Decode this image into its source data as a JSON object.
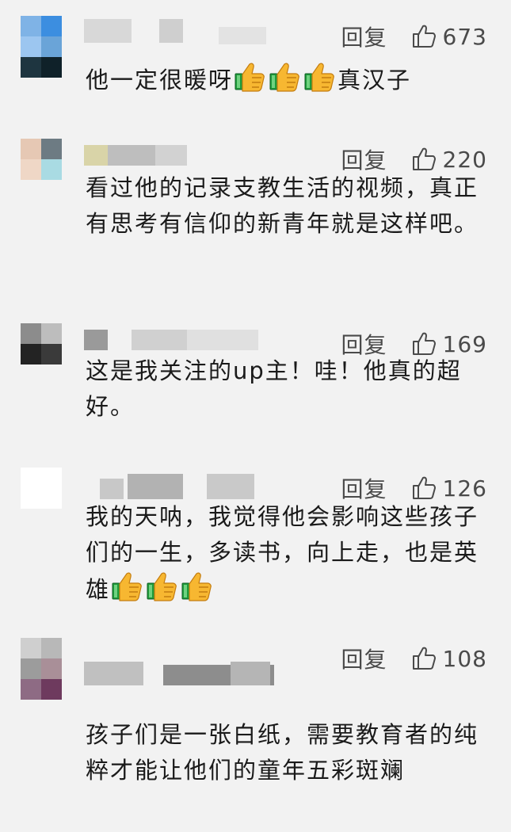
{
  "comments": [
    {
      "reply": "回复",
      "likes": "673",
      "text": "他一定很暖呀",
      "text_suffix": "真汉子",
      "emoji": [
        "thumbs-up-icon",
        "thumbs-up-icon",
        "thumbs-up-icon"
      ],
      "avatar_colors": [
        "#7fb3e6",
        "#3c8ee0",
        "#9cc6f0",
        "#6aa4d8",
        "#1e3540",
        "#0f2129"
      ],
      "name_colors": [
        "#d8d8d8",
        "#cfcfcf",
        "#e3e3e3"
      ]
    },
    {
      "reply": "回复",
      "likes": "220",
      "text": "看过他的记录支教生活的视频，真正有思考有信仰的新青年就是这样吧。",
      "avatar_colors": [
        "#e6c8b4",
        "#6d7b83",
        "#efd7c6",
        "#a9dbe3",
        "#f2f2f2",
        "#f2f2f2"
      ],
      "name_colors": [
        "#d9d4a8",
        "#bebebe",
        "#d2d2d2"
      ]
    },
    {
      "reply": "回复",
      "likes": "169",
      "text": "这是我关注的up主！哇！他真的超好。",
      "avatar_colors": [
        "#8c8c8c",
        "#bdbdbd",
        "#232323",
        "#3a3a3a",
        "#f2f2f2",
        "#f2f2f2"
      ],
      "name_colors": [
        "#9a9a9a",
        "#d0d0d0",
        "#e0e0e0"
      ]
    },
    {
      "reply": "回复",
      "likes": "126",
      "text": "我的天呐，我觉得他会影响这些孩子们的一生，多读书，向上走，也是英雄",
      "text_suffix": "",
      "emoji": [
        "thumbs-up-icon",
        "thumbs-up-icon",
        "thumbs-up-icon"
      ],
      "avatar_colors": [
        "#ffffff",
        "#ffffff",
        "#ffffff",
        "#ffffff",
        "#f2f2f2",
        "#f2f2f2"
      ],
      "name_colors": [
        "#c8c8c8",
        "#b2b2b2",
        "#c9c9c9"
      ]
    },
    {
      "reply": "回复",
      "likes": "108",
      "text": "孩子们是一张白纸，需要教育者的纯粹才能让他们的童年五彩斑斓",
      "avatar_colors": [
        "#cfcfcf",
        "#b8b8b8",
        "#9c9c9c",
        "#a98f98",
        "#8e6b84",
        "#6e3a5e"
      ],
      "name_colors": [
        "#c0c0c0",
        "#8d8d8d",
        "#b5b5b5"
      ]
    }
  ]
}
